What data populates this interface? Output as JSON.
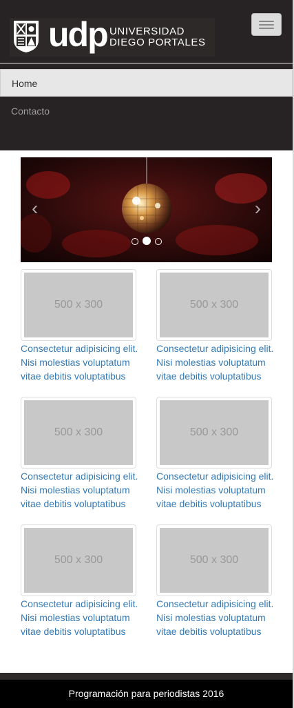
{
  "brand": {
    "logo_word": "udp",
    "logo_line1": "UNIVERSIDAD",
    "logo_line2": "DIEGO PORTALES"
  },
  "nav": {
    "items": [
      {
        "label": "Home",
        "active": true
      },
      {
        "label": "Contacto",
        "active": false
      }
    ]
  },
  "carousel": {
    "prev_icon": "chevron-left-icon",
    "next_icon": "chevron-right-icon",
    "indicator_count": 3,
    "active_index": 1
  },
  "grid": {
    "placeholder": "500 x 300",
    "items": [
      {
        "caption": "Consectetur adipisicing elit. Nisi molestias voluptatum vitae debitis voluptatibus"
      },
      {
        "caption": "Consectetur adipisicing elit. Nisi molestias voluptatum vitae debitis voluptatibus"
      },
      {
        "caption": "Consectetur adipisicing elit. Nisi molestias voluptatum vitae debitis voluptatibus"
      },
      {
        "caption": "Consectetur adipisicing elit. Nisi molestias voluptatum vitae debitis voluptatibus"
      },
      {
        "caption": "Consectetur adipisicing elit. Nisi molestias voluptatum vitae debitis voluptatibus"
      },
      {
        "caption": "Consectetur adipisicing elit. Nisi molestias voluptatum vitae debitis voluptatibus"
      }
    ]
  },
  "footer": {
    "text": "Programación para periodistas 2016"
  },
  "colors": {
    "navbar_bg": "#272324",
    "link": "#337ab7",
    "placeholder_bg": "#c8c8c8",
    "footer_bg": "#000000"
  }
}
